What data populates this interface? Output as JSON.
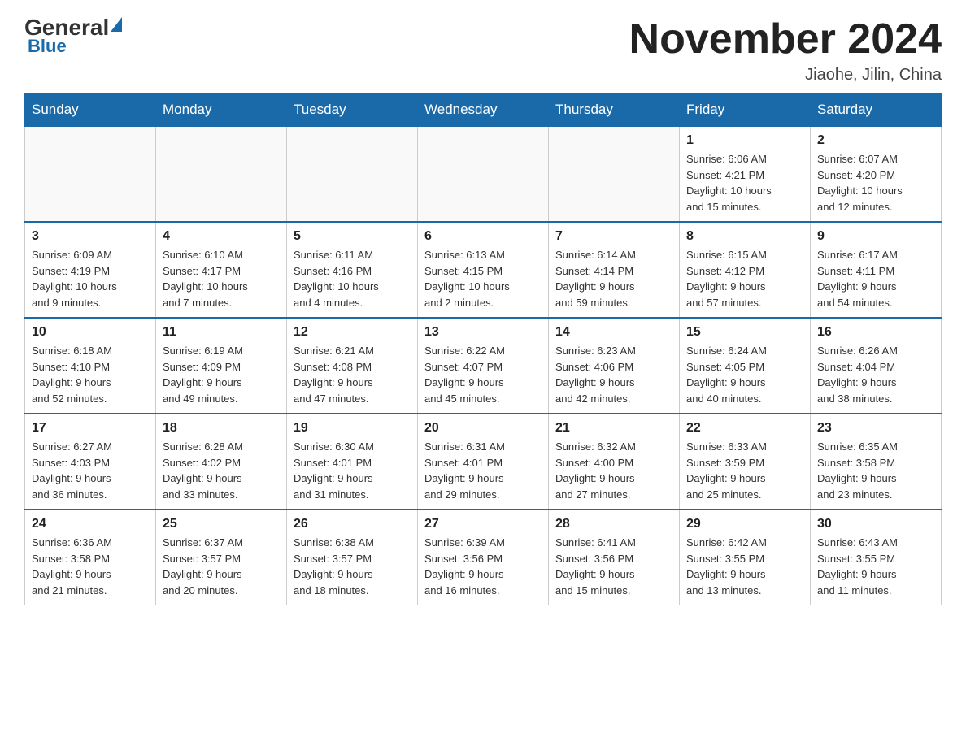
{
  "logo": {
    "general": "General",
    "blue": "Blue"
  },
  "title": "November 2024",
  "location": "Jiaohe, Jilin, China",
  "weekdays": [
    "Sunday",
    "Monday",
    "Tuesday",
    "Wednesday",
    "Thursday",
    "Friday",
    "Saturday"
  ],
  "weeks": [
    [
      {
        "day": "",
        "info": ""
      },
      {
        "day": "",
        "info": ""
      },
      {
        "day": "",
        "info": ""
      },
      {
        "day": "",
        "info": ""
      },
      {
        "day": "",
        "info": ""
      },
      {
        "day": "1",
        "info": "Sunrise: 6:06 AM\nSunset: 4:21 PM\nDaylight: 10 hours\nand 15 minutes."
      },
      {
        "day": "2",
        "info": "Sunrise: 6:07 AM\nSunset: 4:20 PM\nDaylight: 10 hours\nand 12 minutes."
      }
    ],
    [
      {
        "day": "3",
        "info": "Sunrise: 6:09 AM\nSunset: 4:19 PM\nDaylight: 10 hours\nand 9 minutes."
      },
      {
        "day": "4",
        "info": "Sunrise: 6:10 AM\nSunset: 4:17 PM\nDaylight: 10 hours\nand 7 minutes."
      },
      {
        "day": "5",
        "info": "Sunrise: 6:11 AM\nSunset: 4:16 PM\nDaylight: 10 hours\nand 4 minutes."
      },
      {
        "day": "6",
        "info": "Sunrise: 6:13 AM\nSunset: 4:15 PM\nDaylight: 10 hours\nand 2 minutes."
      },
      {
        "day": "7",
        "info": "Sunrise: 6:14 AM\nSunset: 4:14 PM\nDaylight: 9 hours\nand 59 minutes."
      },
      {
        "day": "8",
        "info": "Sunrise: 6:15 AM\nSunset: 4:12 PM\nDaylight: 9 hours\nand 57 minutes."
      },
      {
        "day": "9",
        "info": "Sunrise: 6:17 AM\nSunset: 4:11 PM\nDaylight: 9 hours\nand 54 minutes."
      }
    ],
    [
      {
        "day": "10",
        "info": "Sunrise: 6:18 AM\nSunset: 4:10 PM\nDaylight: 9 hours\nand 52 minutes."
      },
      {
        "day": "11",
        "info": "Sunrise: 6:19 AM\nSunset: 4:09 PM\nDaylight: 9 hours\nand 49 minutes."
      },
      {
        "day": "12",
        "info": "Sunrise: 6:21 AM\nSunset: 4:08 PM\nDaylight: 9 hours\nand 47 minutes."
      },
      {
        "day": "13",
        "info": "Sunrise: 6:22 AM\nSunset: 4:07 PM\nDaylight: 9 hours\nand 45 minutes."
      },
      {
        "day": "14",
        "info": "Sunrise: 6:23 AM\nSunset: 4:06 PM\nDaylight: 9 hours\nand 42 minutes."
      },
      {
        "day": "15",
        "info": "Sunrise: 6:24 AM\nSunset: 4:05 PM\nDaylight: 9 hours\nand 40 minutes."
      },
      {
        "day": "16",
        "info": "Sunrise: 6:26 AM\nSunset: 4:04 PM\nDaylight: 9 hours\nand 38 minutes."
      }
    ],
    [
      {
        "day": "17",
        "info": "Sunrise: 6:27 AM\nSunset: 4:03 PM\nDaylight: 9 hours\nand 36 minutes."
      },
      {
        "day": "18",
        "info": "Sunrise: 6:28 AM\nSunset: 4:02 PM\nDaylight: 9 hours\nand 33 minutes."
      },
      {
        "day": "19",
        "info": "Sunrise: 6:30 AM\nSunset: 4:01 PM\nDaylight: 9 hours\nand 31 minutes."
      },
      {
        "day": "20",
        "info": "Sunrise: 6:31 AM\nSunset: 4:01 PM\nDaylight: 9 hours\nand 29 minutes."
      },
      {
        "day": "21",
        "info": "Sunrise: 6:32 AM\nSunset: 4:00 PM\nDaylight: 9 hours\nand 27 minutes."
      },
      {
        "day": "22",
        "info": "Sunrise: 6:33 AM\nSunset: 3:59 PM\nDaylight: 9 hours\nand 25 minutes."
      },
      {
        "day": "23",
        "info": "Sunrise: 6:35 AM\nSunset: 3:58 PM\nDaylight: 9 hours\nand 23 minutes."
      }
    ],
    [
      {
        "day": "24",
        "info": "Sunrise: 6:36 AM\nSunset: 3:58 PM\nDaylight: 9 hours\nand 21 minutes."
      },
      {
        "day": "25",
        "info": "Sunrise: 6:37 AM\nSunset: 3:57 PM\nDaylight: 9 hours\nand 20 minutes."
      },
      {
        "day": "26",
        "info": "Sunrise: 6:38 AM\nSunset: 3:57 PM\nDaylight: 9 hours\nand 18 minutes."
      },
      {
        "day": "27",
        "info": "Sunrise: 6:39 AM\nSunset: 3:56 PM\nDaylight: 9 hours\nand 16 minutes."
      },
      {
        "day": "28",
        "info": "Sunrise: 6:41 AM\nSunset: 3:56 PM\nDaylight: 9 hours\nand 15 minutes."
      },
      {
        "day": "29",
        "info": "Sunrise: 6:42 AM\nSunset: 3:55 PM\nDaylight: 9 hours\nand 13 minutes."
      },
      {
        "day": "30",
        "info": "Sunrise: 6:43 AM\nSunset: 3:55 PM\nDaylight: 9 hours\nand 11 minutes."
      }
    ]
  ]
}
